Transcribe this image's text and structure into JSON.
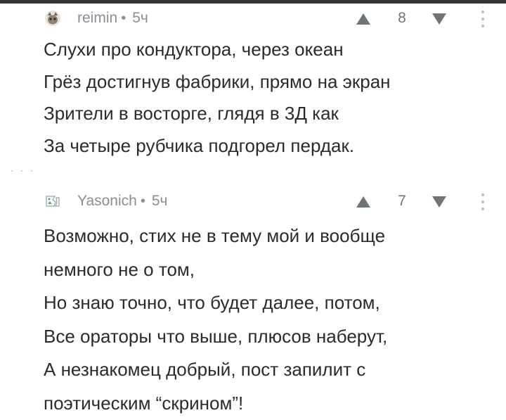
{
  "comments": [
    {
      "author": "reimin",
      "separator": "•",
      "time": "5ч",
      "score": "8",
      "avatar_icon": "cat-avatar-icon",
      "lines": [
        "Слухи про кондуктора, через океан",
        "Грёз достигнув фабрики, прямо на экран",
        "Зрители в восторге, глядя в 3Д как",
        "За четыре рубчика подгорел пердак."
      ]
    },
    {
      "author": "Yasonich",
      "separator": "•",
      "time": "5ч",
      "score": "7",
      "avatar_icon": "broken-image-avatar-icon",
      "lines": [
        "Возможно, стих не в тему мой и вообще",
        "немного не о том,",
        "Но знаю точно, что будет далее, потом,",
        "Все ораторы что выше, плюсов наберут,",
        "А незнакомец добрый, пост запилит с",
        "поэтическим “скрином”!"
      ]
    }
  ],
  "colors": {
    "text": "#2b2b2b",
    "meta": "#8a8f95",
    "vote_arrow": "#6f7478",
    "top_bar": "#333333"
  }
}
